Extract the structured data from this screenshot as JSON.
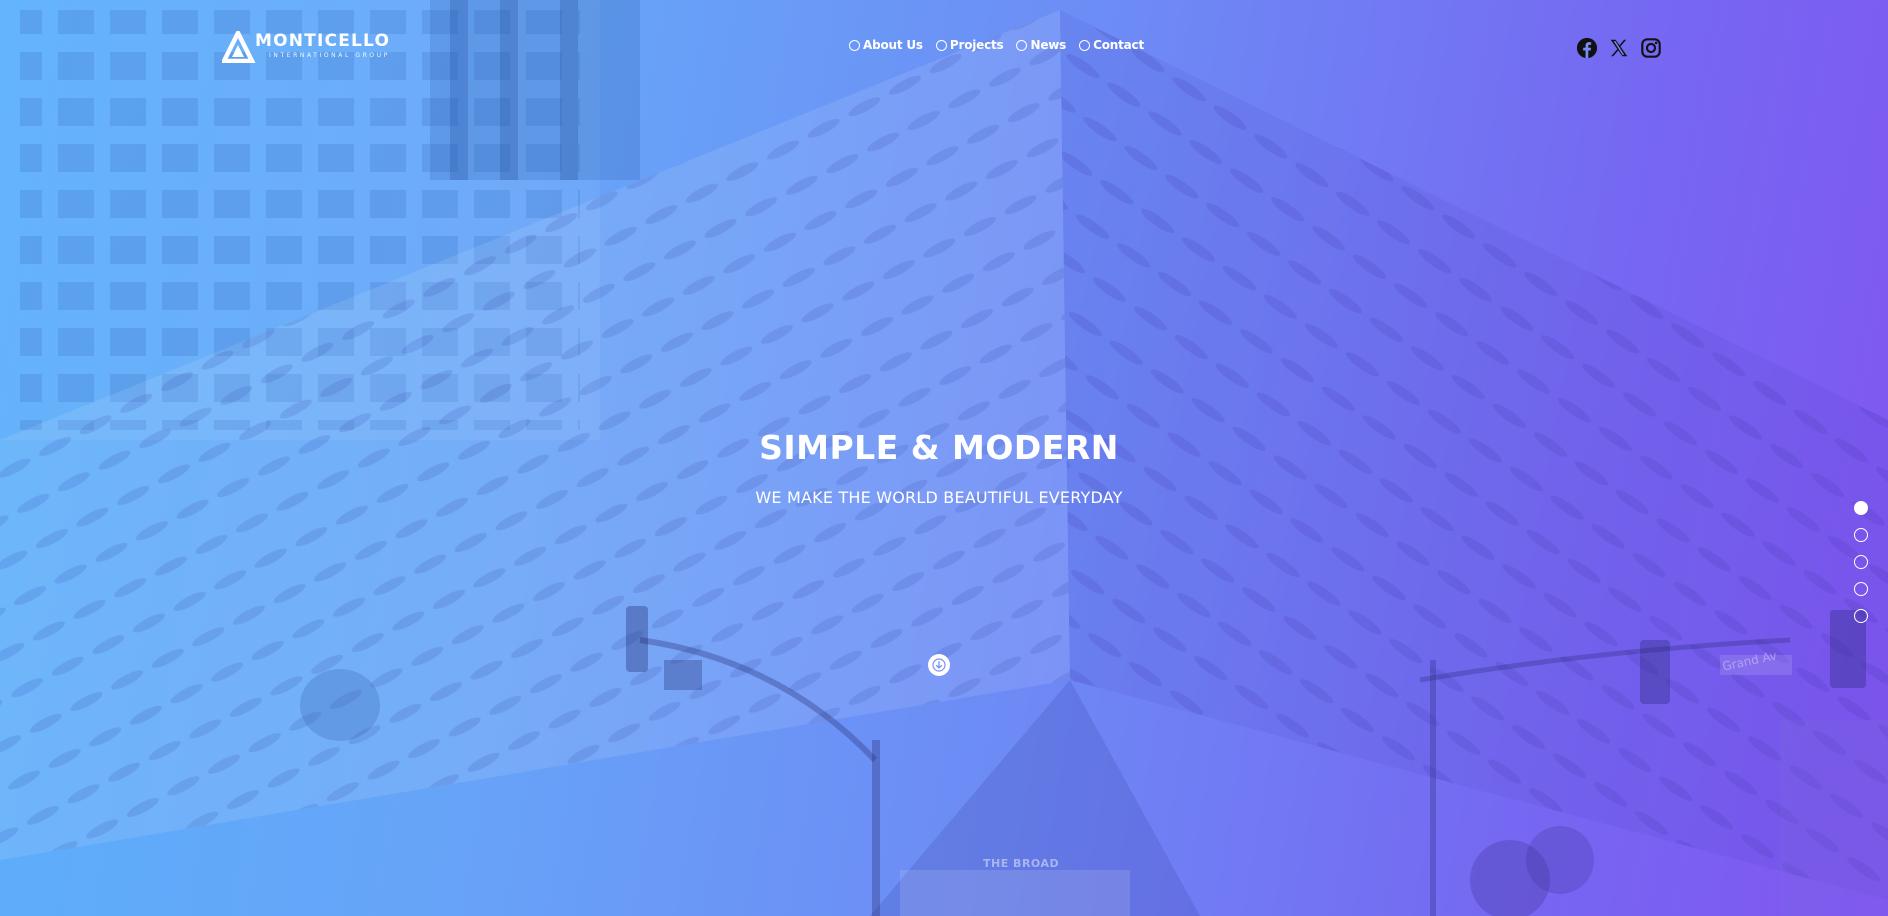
{
  "brand": {
    "name": "MONTICELLO",
    "subtitle": "INTERNATIONAL GROUP"
  },
  "nav": {
    "items": [
      {
        "label": "About Us"
      },
      {
        "label": "Projects"
      },
      {
        "label": "News"
      },
      {
        "label": "Contact"
      }
    ]
  },
  "social": {
    "icons": [
      "facebook-icon",
      "x-twitter-icon",
      "instagram-icon"
    ]
  },
  "hero": {
    "title": "SIMPLE & MODERN",
    "tagline": "WE MAKE THE WORLD BEAUTIFUL EVERYDAY",
    "background_signs": {
      "building": "THE BROAD",
      "street": "Grand Av"
    }
  },
  "pagination": {
    "total": 5,
    "active": 1
  },
  "colors": {
    "gradient_start": "#5bb0fb",
    "gradient_end": "#8155f1",
    "text": "#ffffff"
  }
}
